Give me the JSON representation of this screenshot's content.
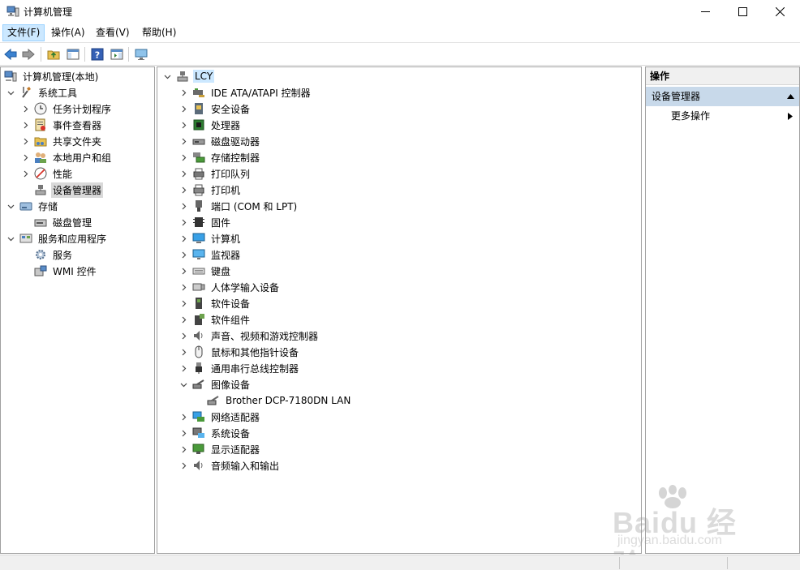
{
  "window": {
    "title": "计算机管理",
    "minimize_glyph": "—",
    "maximize_glyph": "☐",
    "close_glyph": "✕"
  },
  "menu": [
    {
      "label": "文件(F)"
    },
    {
      "label": "操作(A)"
    },
    {
      "label": "查看(V)"
    },
    {
      "label": "帮助(H)"
    }
  ],
  "toolbar": {
    "buttons": [
      "back-icon",
      "forward-icon",
      "up-folder-icon",
      "show-hide-tree-icon",
      "help-icon",
      "action-pane-icon",
      "monitor-icon"
    ]
  },
  "left_tree": [
    {
      "label": "计算机管理(本地)",
      "icon": "computer-management-icon"
    },
    {
      "label": "系统工具",
      "icon": "system-tools-icon"
    },
    {
      "label": "任务计划程序",
      "icon": "clock-icon"
    },
    {
      "label": "事件查看器",
      "icon": "event-viewer-icon"
    },
    {
      "label": "共享文件夹",
      "icon": "shared-folder-icon"
    },
    {
      "label": "本地用户和组",
      "icon": "users-icon"
    },
    {
      "label": "性能",
      "icon": "performance-icon"
    },
    {
      "label": "设备管理器",
      "icon": "device-manager-icon"
    },
    {
      "label": "存储",
      "icon": "storage-icon"
    },
    {
      "label": "磁盘管理",
      "icon": "disk-management-icon"
    },
    {
      "label": "服务和应用程序",
      "icon": "services-apps-icon"
    },
    {
      "label": "服务",
      "icon": "gear-icon"
    },
    {
      "label": "WMI 控件",
      "icon": "wmi-icon"
    }
  ],
  "device_tree": {
    "root": "LCY",
    "items": [
      {
        "label": "IDE ATA/ATAPI 控制器",
        "icon": "ide-controller-icon"
      },
      {
        "label": "安全设备",
        "icon": "security-device-icon"
      },
      {
        "label": "处理器",
        "icon": "processor-icon"
      },
      {
        "label": "磁盘驱动器",
        "icon": "disk-drive-icon"
      },
      {
        "label": "存储控制器",
        "icon": "storage-controller-icon"
      },
      {
        "label": "打印队列",
        "icon": "print-queue-icon"
      },
      {
        "label": "打印机",
        "icon": "printer-icon"
      },
      {
        "label": "端口 (COM 和 LPT)",
        "icon": "port-icon"
      },
      {
        "label": "固件",
        "icon": "firmware-icon"
      },
      {
        "label": "计算机",
        "icon": "computer-icon"
      },
      {
        "label": "监视器",
        "icon": "monitor-icon"
      },
      {
        "label": "键盘",
        "icon": "keyboard-icon"
      },
      {
        "label": "人体学输入设备",
        "icon": "hid-icon"
      },
      {
        "label": "软件设备",
        "icon": "software-device-icon"
      },
      {
        "label": "软件组件",
        "icon": "software-component-icon"
      },
      {
        "label": "声音、视频和游戏控制器",
        "icon": "speaker-icon"
      },
      {
        "label": "鼠标和其他指针设备",
        "icon": "mouse-icon"
      },
      {
        "label": "通用串行总线控制器",
        "icon": "usb-icon"
      },
      {
        "label": "图像设备",
        "icon": "imaging-device-icon",
        "expanded": true
      },
      {
        "label": "Brother DCP-7180DN LAN",
        "icon": "scanner-icon",
        "child": true
      },
      {
        "label": "网络适配器",
        "icon": "network-adapter-icon"
      },
      {
        "label": "系统设备",
        "icon": "system-device-icon"
      },
      {
        "label": "显示适配器",
        "icon": "display-adapter-icon"
      },
      {
        "label": "音频输入和输出",
        "icon": "audio-io-icon"
      }
    ]
  },
  "actions": {
    "header": "操作",
    "section": "设备管理器",
    "more": "更多操作"
  },
  "watermark": {
    "main": "Baidu 经验",
    "sub": "jingyan.baidu.com"
  }
}
